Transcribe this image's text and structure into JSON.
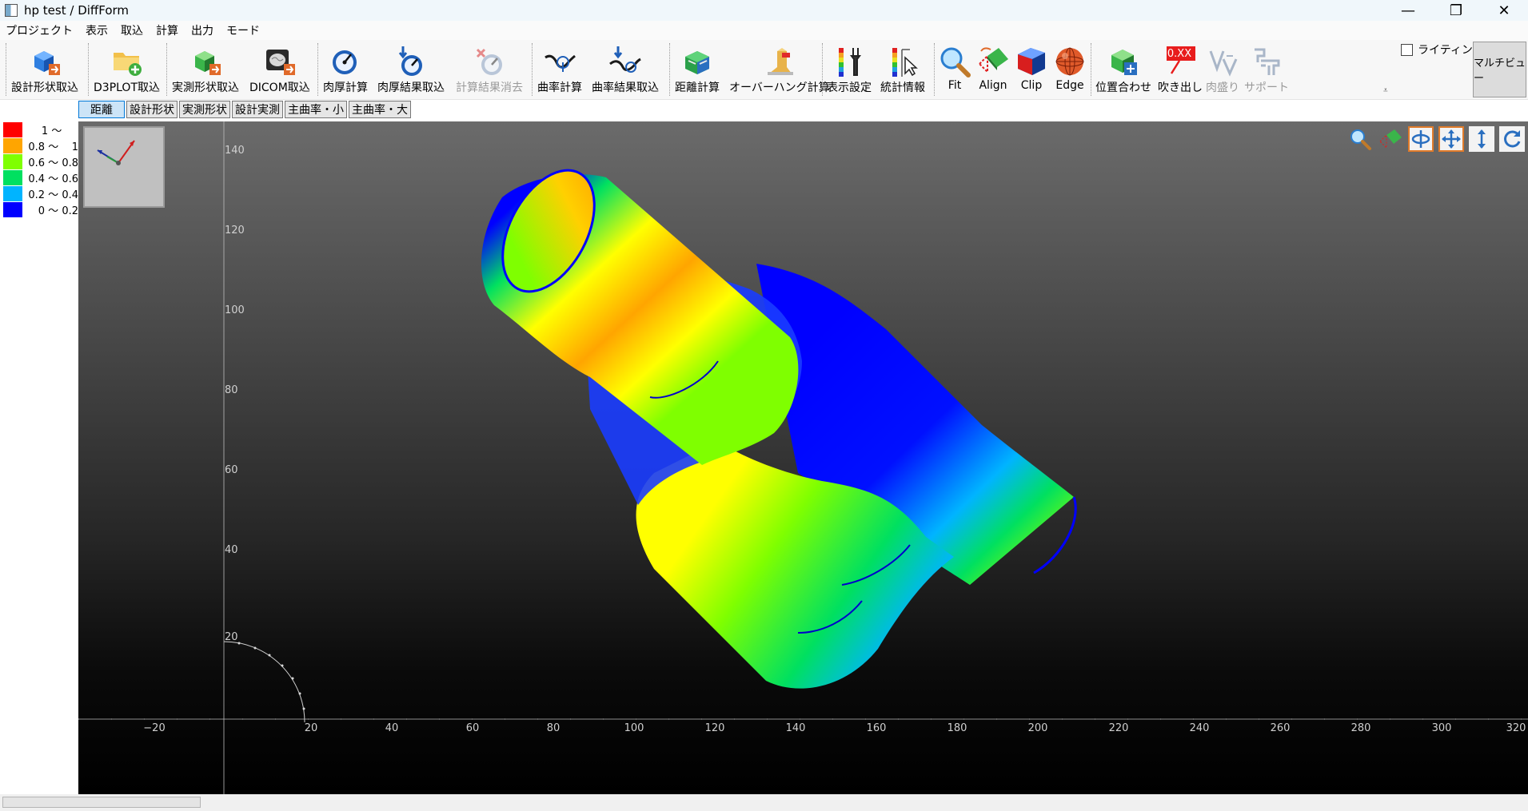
{
  "window": {
    "title": "hp test / DiffForm",
    "controls": {
      "minimize": "—",
      "restore": "❐",
      "close": "✕"
    }
  },
  "menu": [
    "プロジェクト",
    "表示",
    "取込",
    "計算",
    "出力",
    "モード"
  ],
  "toolbar": {
    "buttons": [
      {
        "id": "design-shape-import",
        "label": "設計形状取込",
        "icon": "blue-cube-import-icon",
        "disabled": false
      },
      {
        "id": "d3plot-import",
        "label": "D3PLOT取込",
        "icon": "folder-add-icon",
        "disabled": false
      },
      {
        "id": "measured-shape-import",
        "label": "実測形状取込",
        "icon": "green-cube-import-icon",
        "disabled": false
      },
      {
        "id": "dicom-import",
        "label": "DICOM取込",
        "icon": "dicom-brain-icon",
        "disabled": false
      },
      {
        "id": "thickness-calc",
        "label": "肉厚計算",
        "icon": "gauge-icon",
        "disabled": false
      },
      {
        "id": "thickness-result-import",
        "label": "肉厚結果取込",
        "icon": "gauge-import-icon",
        "disabled": false
      },
      {
        "id": "calc-result-clear",
        "label": "計算結果消去",
        "icon": "gauge-clear-icon",
        "disabled": true
      },
      {
        "id": "curvature-calc",
        "label": "曲率計算",
        "icon": "curvature-icon",
        "disabled": false
      },
      {
        "id": "curvature-result-import",
        "label": "曲率結果取込",
        "icon": "curvature-import-icon",
        "disabled": false
      },
      {
        "id": "distance-calc",
        "label": "距離計算",
        "icon": "distance-cube-icon",
        "disabled": false
      },
      {
        "id": "overhang-calc",
        "label": "オーバーハング計算",
        "icon": "overhang-icon",
        "disabled": false
      },
      {
        "id": "display-settings",
        "label": "表示設定",
        "icon": "colorbar-wrench-icon",
        "disabled": false
      },
      {
        "id": "statistics",
        "label": "統計情報",
        "icon": "colorbar-cursor-icon",
        "disabled": false
      },
      {
        "id": "fit",
        "label": "Fit",
        "icon": "magnifier-icon",
        "disabled": false
      },
      {
        "id": "align",
        "label": "Align",
        "icon": "align-icon",
        "disabled": false
      },
      {
        "id": "clip",
        "label": "Clip",
        "icon": "clip-icon",
        "disabled": false
      },
      {
        "id": "edge",
        "label": "Edge",
        "icon": "edge-sphere-icon",
        "disabled": false
      },
      {
        "id": "registration",
        "label": "位置合わせ",
        "icon": "registration-cube-icon",
        "disabled": false
      },
      {
        "id": "callout",
        "label": "吹き出し",
        "icon": "callout-icon",
        "disabled": false
      },
      {
        "id": "build-up",
        "label": "肉盛り",
        "icon": "build-up-icon",
        "disabled": true
      },
      {
        "id": "support",
        "label": "サポート",
        "icon": "support-icon",
        "disabled": true
      }
    ],
    "callout_badge": "0.XX",
    "lighting_label": "ライティング",
    "lighting_checked": false,
    "multiview_label": "マルチビュー",
    "overflow": "⩡"
  },
  "view_tabs": [
    {
      "label": "距離",
      "active": true
    },
    {
      "label": "設計形状",
      "active": false
    },
    {
      "label": "実測形状",
      "active": false
    },
    {
      "label": "設計実測",
      "active": false
    },
    {
      "label": "主曲率・小",
      "active": false
    },
    {
      "label": "主曲率・大",
      "active": false
    }
  ],
  "legend": [
    {
      "label": "1 ～     ",
      "color": "#ff0000"
    },
    {
      "label": "0.8 ～    1",
      "color": "#ffa500"
    },
    {
      "label": "0.6 ～ 0.8",
      "color": "#7fff00"
    },
    {
      "label": "0.4 ～ 0.6",
      "color": "#00e060"
    },
    {
      "label": "0.2 ～ 0.4",
      "color": "#00b4ff"
    },
    {
      "label": "0 ～ 0.2",
      "color": "#0000ff"
    }
  ],
  "viewport": {
    "x_ticks": [
      "−20",
      "20",
      "40",
      "60",
      "80",
      "100",
      "120",
      "140",
      "160",
      "180",
      "200",
      "220",
      "240",
      "260",
      "280",
      "300",
      "320"
    ],
    "y_ticks": [
      "140",
      "120",
      "100",
      "80",
      "60",
      "40",
      "20"
    ],
    "tools": [
      "zoom-icon",
      "align-view-icon",
      "rotate-icon",
      "pan-icon",
      "zoom-vertical-icon",
      "reset-view-icon"
    ]
  }
}
